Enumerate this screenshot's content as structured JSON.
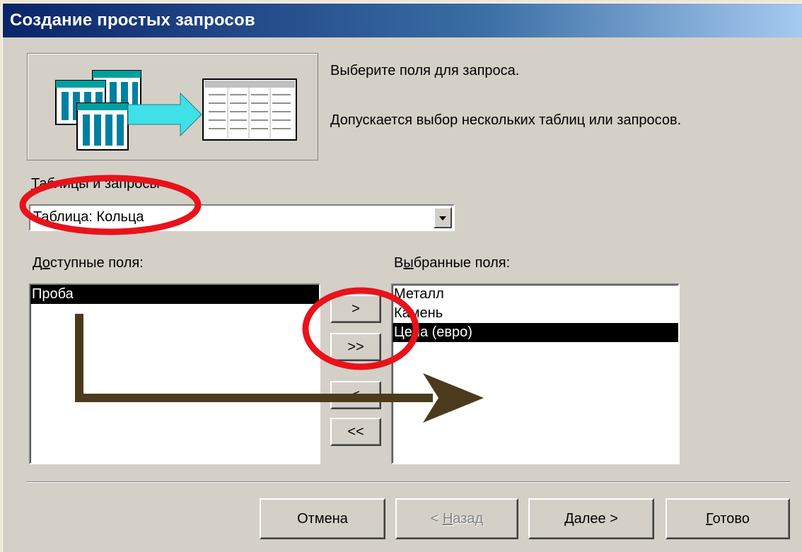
{
  "window": {
    "title": "Создание простых запросов"
  },
  "instructions": {
    "line1": "Выберите поля для запроса.",
    "line2": "Допускается выбор нескольких таблиц или запросов."
  },
  "tables": {
    "label": "Таблицы и запросы",
    "label_accel": "Т",
    "label_rest": "аблицы и запросы",
    "selected": "Таблица: Кольца"
  },
  "available": {
    "label_pre": "Д",
    "label_accel": "о",
    "label_rest": "ступные поля:",
    "items": [
      {
        "label": "Проба",
        "selected": true
      }
    ]
  },
  "selected_fields": {
    "label_pre": "В",
    "label_accel": "ы",
    "label_rest": "бранные поля:",
    "items": [
      {
        "label": "Металл",
        "selected": false
      },
      {
        "label": "Камень",
        "selected": false
      },
      {
        "label": "Цена (евро)",
        "selected": true
      }
    ]
  },
  "move_buttons": {
    "add": ">",
    "add_all": ">>",
    "remove": "<",
    "remove_all": "<<"
  },
  "footer": {
    "cancel": "Отмена",
    "back_pre": "< ",
    "back_accel": "Н",
    "back_rest": "азад",
    "next_accel": "Д",
    "next_rest": "алее >",
    "finish_accel": "Г",
    "finish_rest": "отово"
  },
  "colors": {
    "annotation_circle": "#e8121b",
    "annotation_arrow": "#4b3b1c",
    "title_gradient_start": "#0a246a",
    "title_gradient_end": "#a6caf0"
  }
}
